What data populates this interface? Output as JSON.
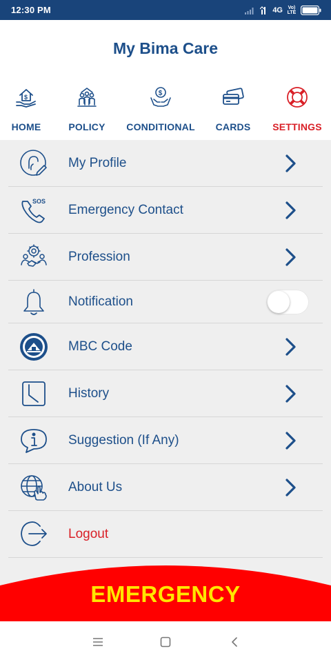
{
  "status_bar": {
    "time": "12:30 PM",
    "network": "4G",
    "volte": "Vo)\nLTE"
  },
  "app": {
    "title": "My Bima Care"
  },
  "nav": {
    "items": [
      {
        "label": "HOME",
        "icon": "home-dollar-icon",
        "active": false
      },
      {
        "label": "POLICY",
        "icon": "family-policy-icon",
        "active": false
      },
      {
        "label": "CONDITIONAL",
        "icon": "hand-coin-icon",
        "active": false
      },
      {
        "label": "CARDS",
        "icon": "cards-icon",
        "active": false
      },
      {
        "label": "SETTINGS",
        "icon": "lifebuoy-icon",
        "active": true
      }
    ]
  },
  "menu": {
    "items": [
      {
        "label": "My Profile",
        "icon": "profile-icon",
        "trailing": "chevron"
      },
      {
        "label": "Emergency Contact",
        "icon": "phone-sos-icon",
        "badge": "SOS",
        "trailing": "chevron"
      },
      {
        "label": "Profession",
        "icon": "profession-icon",
        "trailing": "chevron"
      },
      {
        "label": "Notification",
        "icon": "bell-icon",
        "trailing": "toggle",
        "toggle_on": false
      },
      {
        "label": "MBC Code",
        "icon": "mbc-seal-icon",
        "trailing": "chevron"
      },
      {
        "label": "History",
        "icon": "clock-icon",
        "trailing": "chevron"
      },
      {
        "label": "Suggestion (If Any)",
        "icon": "info-bubble-icon",
        "trailing": "chevron"
      },
      {
        "label": "About Us",
        "icon": "globe-hand-icon",
        "trailing": "chevron"
      },
      {
        "label": "Logout",
        "icon": "logout-icon",
        "trailing": "none",
        "danger": true
      }
    ]
  },
  "emergency": {
    "label": "EMERGENCY"
  },
  "colors": {
    "primary": "#1d4f8a",
    "status_bar": "#19447a",
    "danger": "#d92027",
    "emergency_bg": "#ff0000",
    "emergency_text": "#ffe600",
    "menu_bg": "#efefef"
  }
}
